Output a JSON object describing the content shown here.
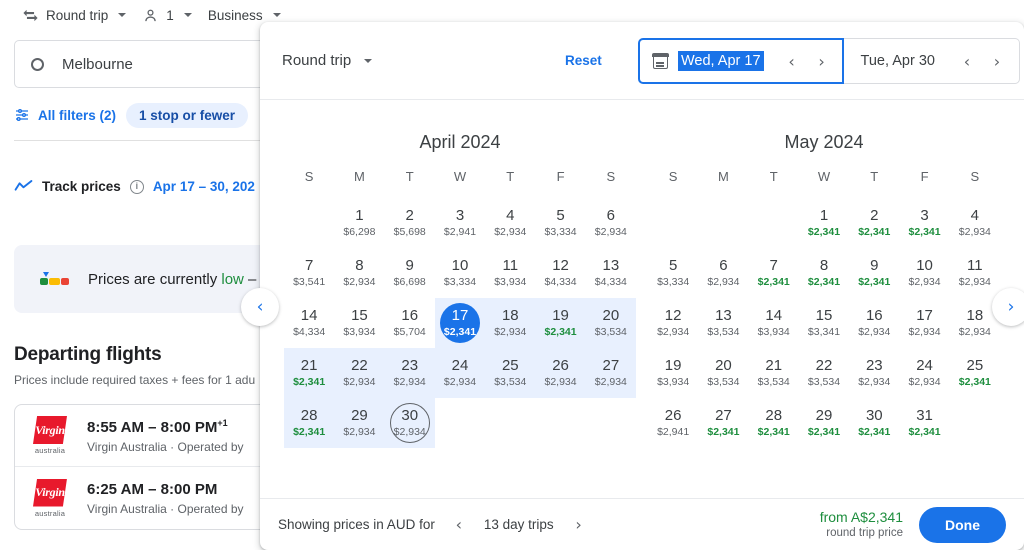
{
  "topbar": {
    "trip_type": "Round trip",
    "passengers": "1",
    "cabin": "Business"
  },
  "search": {
    "origin_value": "Melbourne",
    "all_filters": "All filters (2)",
    "stops_chip": "1 stop or fewer"
  },
  "track": {
    "label": "Track prices",
    "info": "i",
    "dates": "Apr 17 – 30, 202"
  },
  "price_insight": {
    "text_before": "Prices are currently ",
    "low_word": "low",
    "text_after": " –"
  },
  "results": {
    "heading": "Departing flights",
    "subheading": "Prices include required taxes + fees for 1 adu",
    "flights": [
      {
        "logo_text": "Virgin",
        "logo_caption": "australia",
        "times": "8:55 AM – 8:00 PM",
        "plus_days": "+1",
        "carrier": "Virgin Australia · Operated by"
      },
      {
        "logo_text": "Virgin",
        "logo_caption": "australia",
        "times": "6:25 AM – 8:00 PM",
        "plus_days": "",
        "carrier": "Virgin Australia · Operated by"
      }
    ]
  },
  "dialog": {
    "trip_type": "Round trip",
    "reset_label": "Reset",
    "departure_date": "Wed, Apr 17",
    "return_date": "Tue, Apr 30",
    "prev_chevron": "‹",
    "next_chevron": "›",
    "footer": {
      "showing_prices": "Showing prices in AUD for",
      "trip_length": "13 day trips",
      "prev_chevron": "‹",
      "next_chevron": "›",
      "from_price": "from A$2,341",
      "price_caption": "round trip price",
      "done_label": "Done"
    },
    "side_nav": {
      "prev": "‹",
      "next": "›"
    },
    "dow": [
      "S",
      "M",
      "T",
      "W",
      "T",
      "F",
      "S"
    ],
    "months": [
      {
        "title": "April 2024",
        "lead_blanks": 1,
        "days": [
          {
            "n": "1",
            "price": "$6,298",
            "green": false
          },
          {
            "n": "2",
            "price": "$5,698",
            "green": false
          },
          {
            "n": "3",
            "price": "$2,941",
            "green": false
          },
          {
            "n": "4",
            "price": "$2,934",
            "green": false
          },
          {
            "n": "5",
            "price": "$3,334",
            "green": false
          },
          {
            "n": "6",
            "price": "$2,934",
            "green": false
          },
          {
            "n": "7",
            "price": "$3,541",
            "green": false
          },
          {
            "n": "8",
            "price": "$2,934",
            "green": false
          },
          {
            "n": "9",
            "price": "$6,698",
            "green": false
          },
          {
            "n": "10",
            "price": "$3,334",
            "green": false
          },
          {
            "n": "11",
            "price": "$3,934",
            "green": false
          },
          {
            "n": "12",
            "price": "$4,334",
            "green": false
          },
          {
            "n": "13",
            "price": "$4,334",
            "green": false
          },
          {
            "n": "14",
            "price": "$4,334",
            "green": false
          },
          {
            "n": "15",
            "price": "$3,934",
            "green": false
          },
          {
            "n": "16",
            "price": "$5,704",
            "green": false
          },
          {
            "n": "17",
            "price": "$2,341",
            "green": true,
            "selected": true,
            "band": true
          },
          {
            "n": "18",
            "price": "$2,934",
            "green": false,
            "band": true
          },
          {
            "n": "19",
            "price": "$2,341",
            "green": true,
            "band": true
          },
          {
            "n": "20",
            "price": "$3,534",
            "green": false,
            "band": true
          },
          {
            "n": "21",
            "price": "$2,341",
            "green": true,
            "band": true
          },
          {
            "n": "22",
            "price": "$2,934",
            "green": false,
            "band": true
          },
          {
            "n": "23",
            "price": "$2,934",
            "green": false,
            "band": true
          },
          {
            "n": "24",
            "price": "$2,934",
            "green": false,
            "band": true
          },
          {
            "n": "25",
            "price": "$3,534",
            "green": false,
            "band": true
          },
          {
            "n": "26",
            "price": "$2,934",
            "green": false,
            "band": true
          },
          {
            "n": "27",
            "price": "$2,934",
            "green": false,
            "band": true
          },
          {
            "n": "28",
            "price": "$2,341",
            "green": true,
            "band": true
          },
          {
            "n": "29",
            "price": "$2,934",
            "green": false,
            "band": true
          },
          {
            "n": "30",
            "price": "$2,934",
            "green": false,
            "band": true,
            "return": true
          }
        ]
      },
      {
        "title": "May 2024",
        "lead_blanks": 3,
        "days": [
          {
            "n": "1",
            "price": "$2,341",
            "green": true
          },
          {
            "n": "2",
            "price": "$2,341",
            "green": true
          },
          {
            "n": "3",
            "price": "$2,341",
            "green": true
          },
          {
            "n": "4",
            "price": "$2,934",
            "green": false
          },
          {
            "n": "5",
            "price": "$3,334",
            "green": false
          },
          {
            "n": "6",
            "price": "$2,934",
            "green": false
          },
          {
            "n": "7",
            "price": "$2,341",
            "green": true
          },
          {
            "n": "8",
            "price": "$2,341",
            "green": true
          },
          {
            "n": "9",
            "price": "$2,341",
            "green": true
          },
          {
            "n": "10",
            "price": "$2,934",
            "green": false
          },
          {
            "n": "11",
            "price": "$2,934",
            "green": false
          },
          {
            "n": "12",
            "price": "$2,934",
            "green": false
          },
          {
            "n": "13",
            "price": "$3,534",
            "green": false
          },
          {
            "n": "14",
            "price": "$3,934",
            "green": false
          },
          {
            "n": "15",
            "price": "$3,341",
            "green": false
          },
          {
            "n": "16",
            "price": "$2,934",
            "green": false
          },
          {
            "n": "17",
            "price": "$2,934",
            "green": false
          },
          {
            "n": "18",
            "price": "$2,934",
            "green": false
          },
          {
            "n": "19",
            "price": "$3,934",
            "green": false
          },
          {
            "n": "20",
            "price": "$3,534",
            "green": false
          },
          {
            "n": "21",
            "price": "$3,534",
            "green": false
          },
          {
            "n": "22",
            "price": "$3,534",
            "green": false
          },
          {
            "n": "23",
            "price": "$2,934",
            "green": false
          },
          {
            "n": "24",
            "price": "$2,934",
            "green": false
          },
          {
            "n": "25",
            "price": "$2,341",
            "green": true
          },
          {
            "n": "26",
            "price": "$2,941",
            "green": false
          },
          {
            "n": "27",
            "price": "$2,341",
            "green": true
          },
          {
            "n": "28",
            "price": "$2,341",
            "green": true
          },
          {
            "n": "29",
            "price": "$2,341",
            "green": true
          },
          {
            "n": "30",
            "price": "$2,341",
            "green": true
          },
          {
            "n": "31",
            "price": "$2,341",
            "green": true
          }
        ]
      }
    ]
  },
  "colors": {
    "accent": "#1a73e8",
    "green": "#1e8e3e",
    "range_band": "#e8f0fe",
    "text": "#3c4043"
  }
}
